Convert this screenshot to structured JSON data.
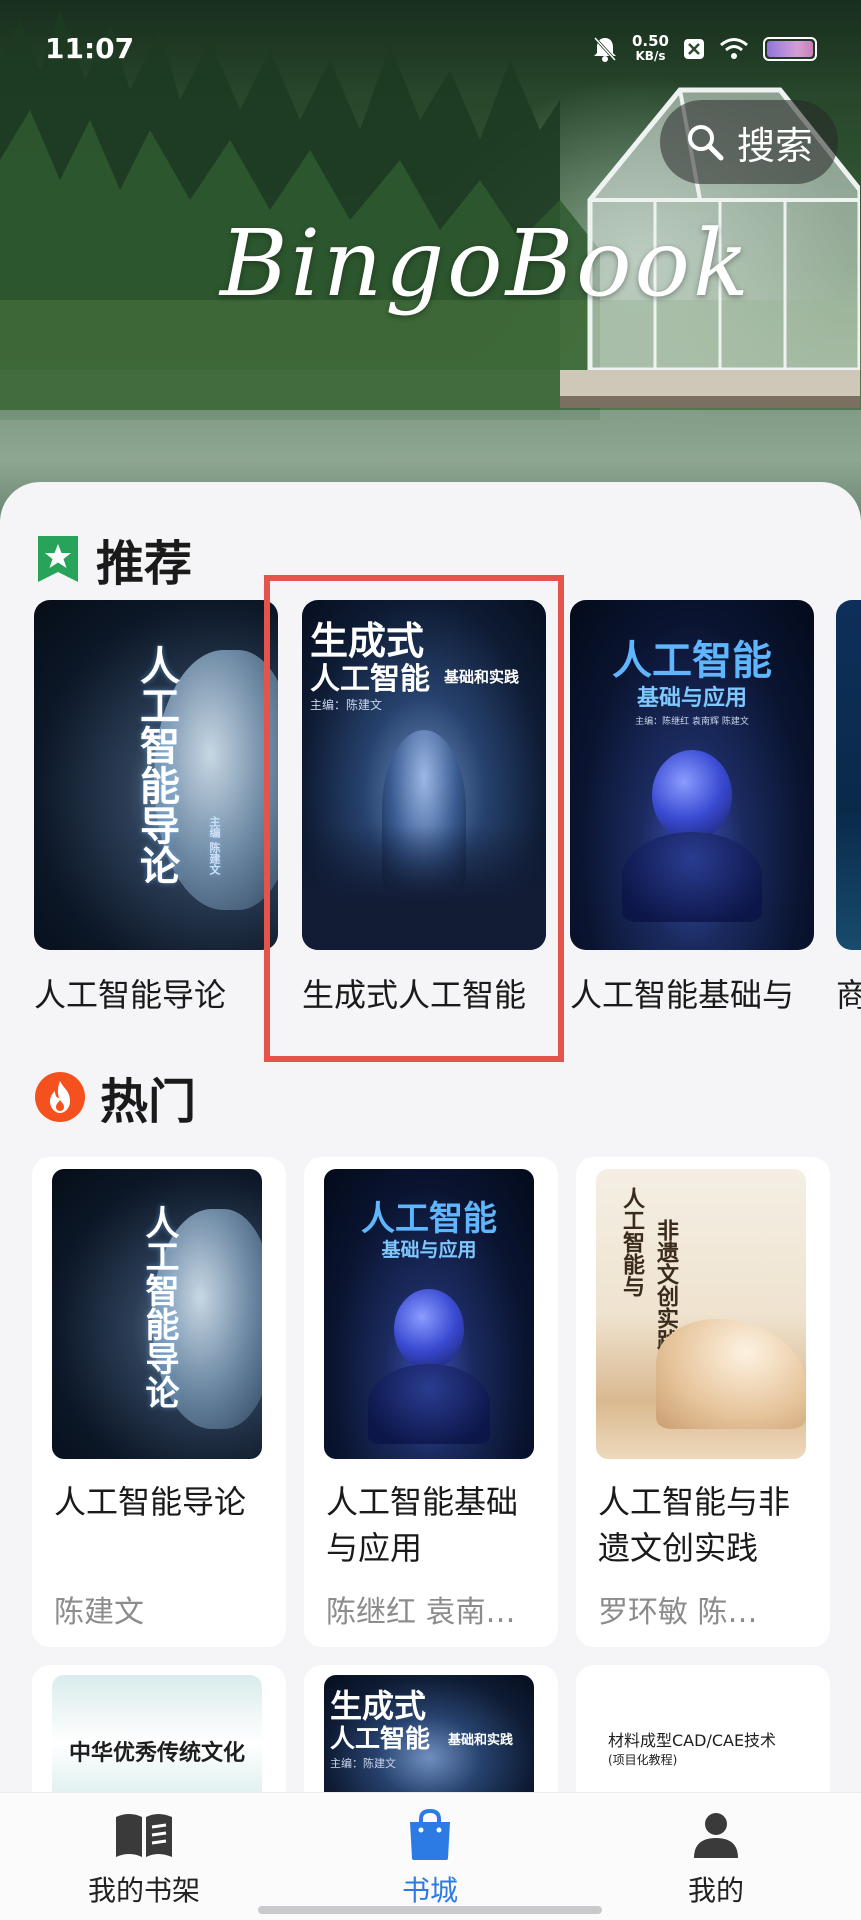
{
  "status_bar": {
    "time": "11:07",
    "net_speed_value": "0.50",
    "net_speed_unit": "KB/s"
  },
  "header": {
    "brand": "BingoBook",
    "search_label": "搜索"
  },
  "recommend": {
    "title": "推荐",
    "items": [
      {
        "title": "人工智能导论",
        "cover_lines": [
          "人工智能导论"
        ],
        "cover_editor": "主编  陈建文"
      },
      {
        "title": "生成式人工智能",
        "cover_lines": [
          "生成式",
          "人工智能",
          "基础和实践"
        ],
        "cover_editor": "主编：陈建文",
        "selected": true
      },
      {
        "title": "人工智能基础与",
        "cover_lines": [
          "人工智能",
          "基础与应用"
        ],
        "cover_editor": "主编：陈继红  袁南辉  陈建文"
      },
      {
        "title": "商"
      }
    ]
  },
  "hot": {
    "title": "热门",
    "items": [
      {
        "title": "人工智能导论",
        "author": "陈建文"
      },
      {
        "title": "人工智能基础与应用",
        "author": "陈继红 袁南…"
      },
      {
        "title": "人工智能与非遗文创实践",
        "author": "罗环敏 陈…",
        "cover_lines": [
          "人工智能与",
          "非遗文创实践"
        ]
      }
    ],
    "row2": [
      {
        "cover_lines": [
          "中华优秀传统文化"
        ]
      },
      {
        "cover_lines": [
          "生成式",
          "人工智能",
          "基础和实践"
        ],
        "cover_editor": "主编：陈建文"
      },
      {
        "cover_lines": [
          "材料成型CAD/CAE技术",
          "(项目化教程)"
        ]
      }
    ]
  },
  "bottom_nav": {
    "items": [
      {
        "label": "我的书架",
        "icon": "book-icon",
        "active": false
      },
      {
        "label": "书城",
        "icon": "shopping-bag-icon",
        "active": true
      },
      {
        "label": "我的",
        "icon": "person-icon",
        "active": false
      }
    ]
  },
  "colors": {
    "accent": "#2c7be5",
    "highlight_box": "#e5544b",
    "recommend_badge": "#28a45a",
    "hot_badge": "#f4511e"
  }
}
